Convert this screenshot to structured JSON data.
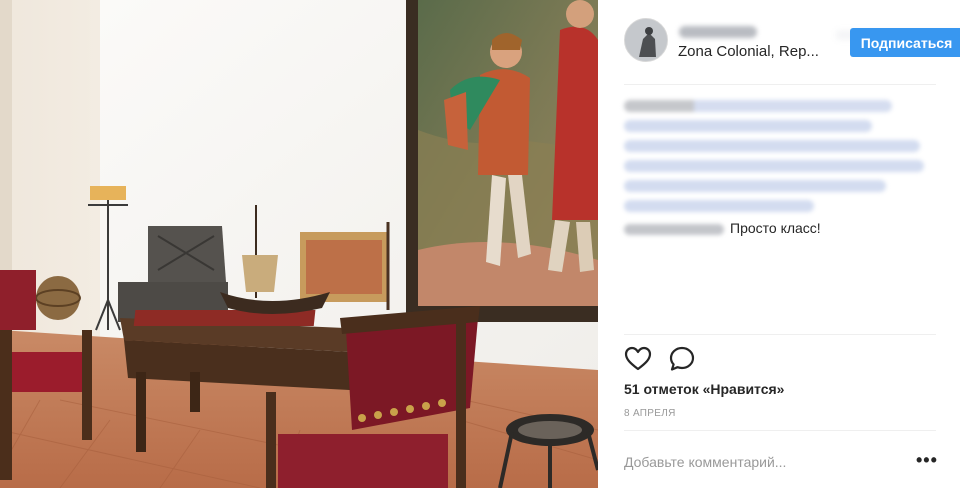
{
  "post": {
    "location": "Zona Colonial, Rep...",
    "follow_label": "Подписаться",
    "reply_text": "Просто класс!",
    "likes_text": "51 отметок «Нравится»",
    "date_text": "8 АПРЕЛЯ",
    "comment_placeholder": "Добавьте комментарий...",
    "more_label": "•••"
  },
  "colors": {
    "follow_button": "#3897f0",
    "blurred_hashtags": "#d3dcf0",
    "blurred_text": "#c3c5ca",
    "secondary_text": "#999999"
  },
  "icons": [
    "heart-icon",
    "comment-bubble-icon",
    "more-options-icon"
  ]
}
